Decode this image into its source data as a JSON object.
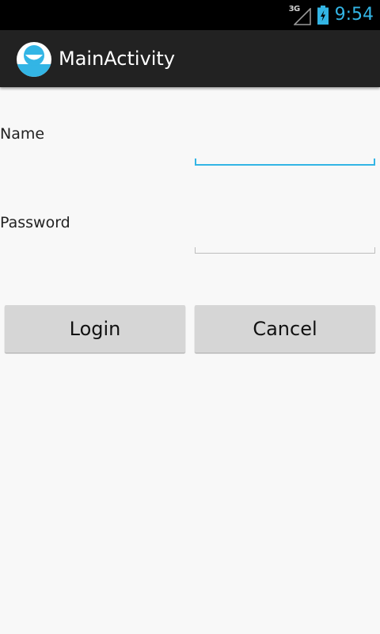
{
  "status_bar": {
    "network_type": "3G",
    "time": "9:54",
    "icons": [
      "signal-icon",
      "battery-charging-icon"
    ]
  },
  "action_bar": {
    "title": "MainActivity",
    "app_icon": "app-launcher-icon"
  },
  "form": {
    "name_label": "Name",
    "name_value": "",
    "password_label": "Password",
    "password_value": ""
  },
  "buttons": {
    "login_label": "Login",
    "cancel_label": "Cancel"
  },
  "colors": {
    "accent": "#33b5e5",
    "action_bar": "#222222",
    "background": "#f8f8f8",
    "button": "#d6d6d6"
  }
}
